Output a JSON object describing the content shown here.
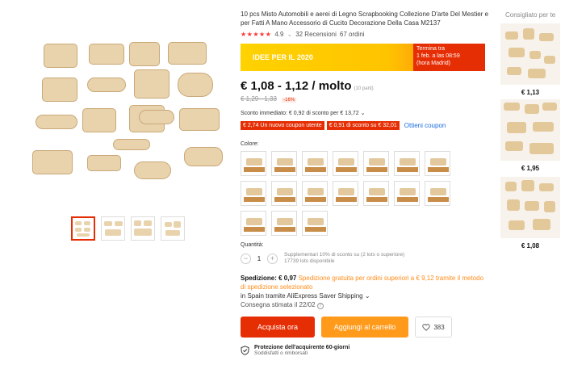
{
  "product": {
    "title": "10 pcs Misto Automobili e aerei di Legno Scrapbooking Collezione D'arte Del Mestier e per Fatti A Mano Accessorio di Cucito Decorazione Della Casa M2137",
    "stars": "★★★★★",
    "rating": "4.9",
    "reviews": "32 Recensioni",
    "orders": "67 ordini"
  },
  "banner": {
    "label": "IDEE PER IL 2020",
    "ends_line1": "Termina tra",
    "ends_line2": "1 feb. a las 08:59",
    "ends_line3": "(hora Madrid)"
  },
  "price": {
    "current": "€ 1,08 - 1,12 / molto",
    "unit_note": "(10 parti)",
    "old": "€ 1,29 - 1,33",
    "discount_pct": "-16%"
  },
  "discount_text": "Sconto immediato: € 0,92 di sconto per € 13,72 ⌄",
  "coupons": {
    "c1": "€ 2,74 Un nuovo coupon utente",
    "c2": "€ 0,91 di sconto su € 32,01",
    "link": "Ottieni coupon"
  },
  "colors_label": "Colore:",
  "quantity": {
    "label": "Quantità:",
    "minus": "−",
    "value": "1",
    "plus": "+",
    "note1": "Supplementari 10% di sconto su (2 lots o superiore)",
    "note2": "17739 lots disponibile"
  },
  "shipping": {
    "label": "Spedizione: € 0,97",
    "free_note": "Spedizione gratuita per ordini superiori a € 9,12 tramite il metodo di spedizione selezionato",
    "method": "in Spain tramite AliExpress Saver Shipping ⌄",
    "delivery_label": "Consegna stimata il",
    "delivery_date": "22/02",
    "delivery_icon": "question-icon"
  },
  "actions": {
    "buy": "Acquista ora",
    "cart": "Aggiungi al carrello",
    "wishlist_count": "383"
  },
  "protection": {
    "title": "Protezione dell'acquirente 60-giorni",
    "subtitle": "Soddisfatti o rimborsati"
  },
  "recommended": {
    "title": "Consigliato per te",
    "items": [
      {
        "price": "€ 1,13"
      },
      {
        "price": "€ 1,95"
      },
      {
        "price": "€ 1,08"
      }
    ]
  },
  "colors": {
    "accent_red": "#e62e04",
    "accent_orange": "#ff9a1a",
    "link_blue": "#1a6cdd"
  }
}
